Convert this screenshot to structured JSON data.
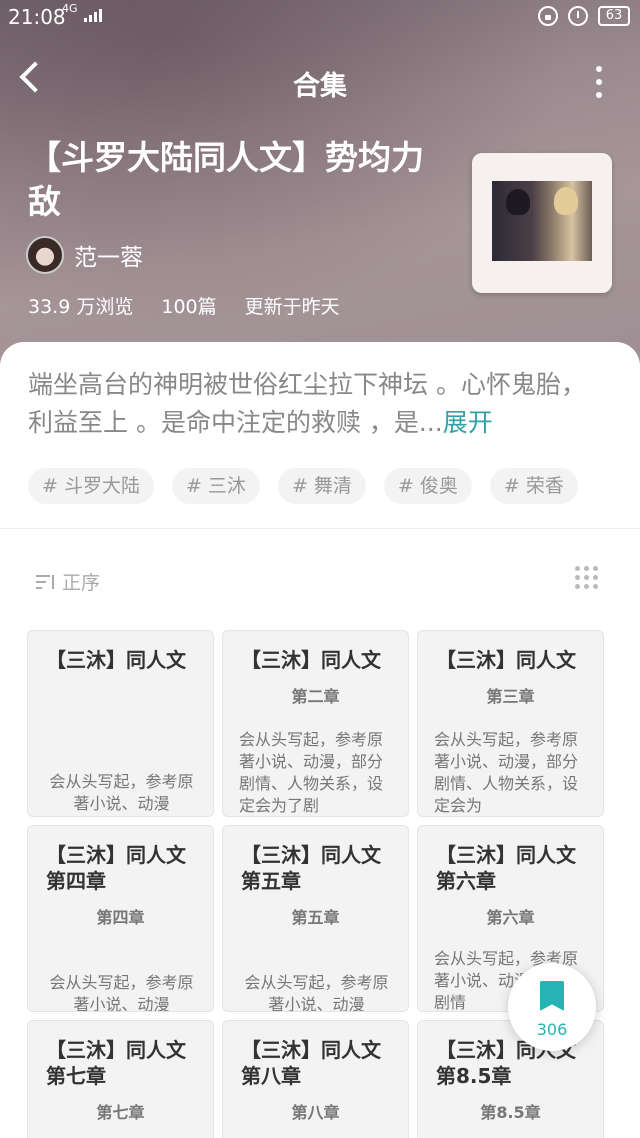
{
  "status_bar": {
    "time": "21:08",
    "network": "4G",
    "battery": "63"
  },
  "nav": {
    "title": "合集"
  },
  "collection": {
    "title": "【斗罗大陆同人文】势均力敌",
    "author": "范一蓉",
    "views": "33.9 万浏览",
    "count": "100篇",
    "updated": "更新于昨天"
  },
  "description": {
    "text": "端坐高台的神明被世俗红尘拉下神坛 。心怀鬼胎，利益至上 。是命中注定的救赎 ，是...",
    "expand_label": "展开"
  },
  "tags": [
    "# 斗罗大陆",
    "# 三沐",
    "# 舞清",
    "# 俊奥",
    "# 荣香"
  ],
  "sort": {
    "label": "正序"
  },
  "cards": [
    {
      "title": "【三沐】同人文",
      "subtitle": "",
      "body": "会从头写起，参考原著小说、动漫"
    },
    {
      "title": "【三沐】同人文",
      "subtitle": "第二章",
      "body": "会从头写起，参考原著小说、动漫，部分剧情、人物关系，设定会为了剧"
    },
    {
      "title": "【三沐】同人文",
      "subtitle": "第三章",
      "body": "会从头写起，参考原著小说、动漫，部分剧情、人物关系，设定会为"
    },
    {
      "title": "【三沐】同人文第四章",
      "subtitle": "第四章",
      "body": "会从头写起，参考原著小说、动漫"
    },
    {
      "title": "【三沐】同人文第五章",
      "subtitle": "第五章",
      "body": "会从头写起，参考原著小说、动漫"
    },
    {
      "title": "【三沐】同人文第六章",
      "subtitle": "第六章",
      "body": "会从头写起，参考原著小说、动漫，部分剧情"
    },
    {
      "title": "【三沐】同人文第七章",
      "subtitle": "第七章",
      "body": ""
    },
    {
      "title": "【三沐】同人文第八章",
      "subtitle": "第八章",
      "body": ""
    },
    {
      "title": "【三沐】同人文第8.5章",
      "subtitle": "第8.5章",
      "body": ""
    }
  ],
  "fab": {
    "count": "306",
    "icon": "bookmark-icon",
    "color": "#27b3b3"
  },
  "colors": {
    "accent": "#2fa3a3"
  }
}
